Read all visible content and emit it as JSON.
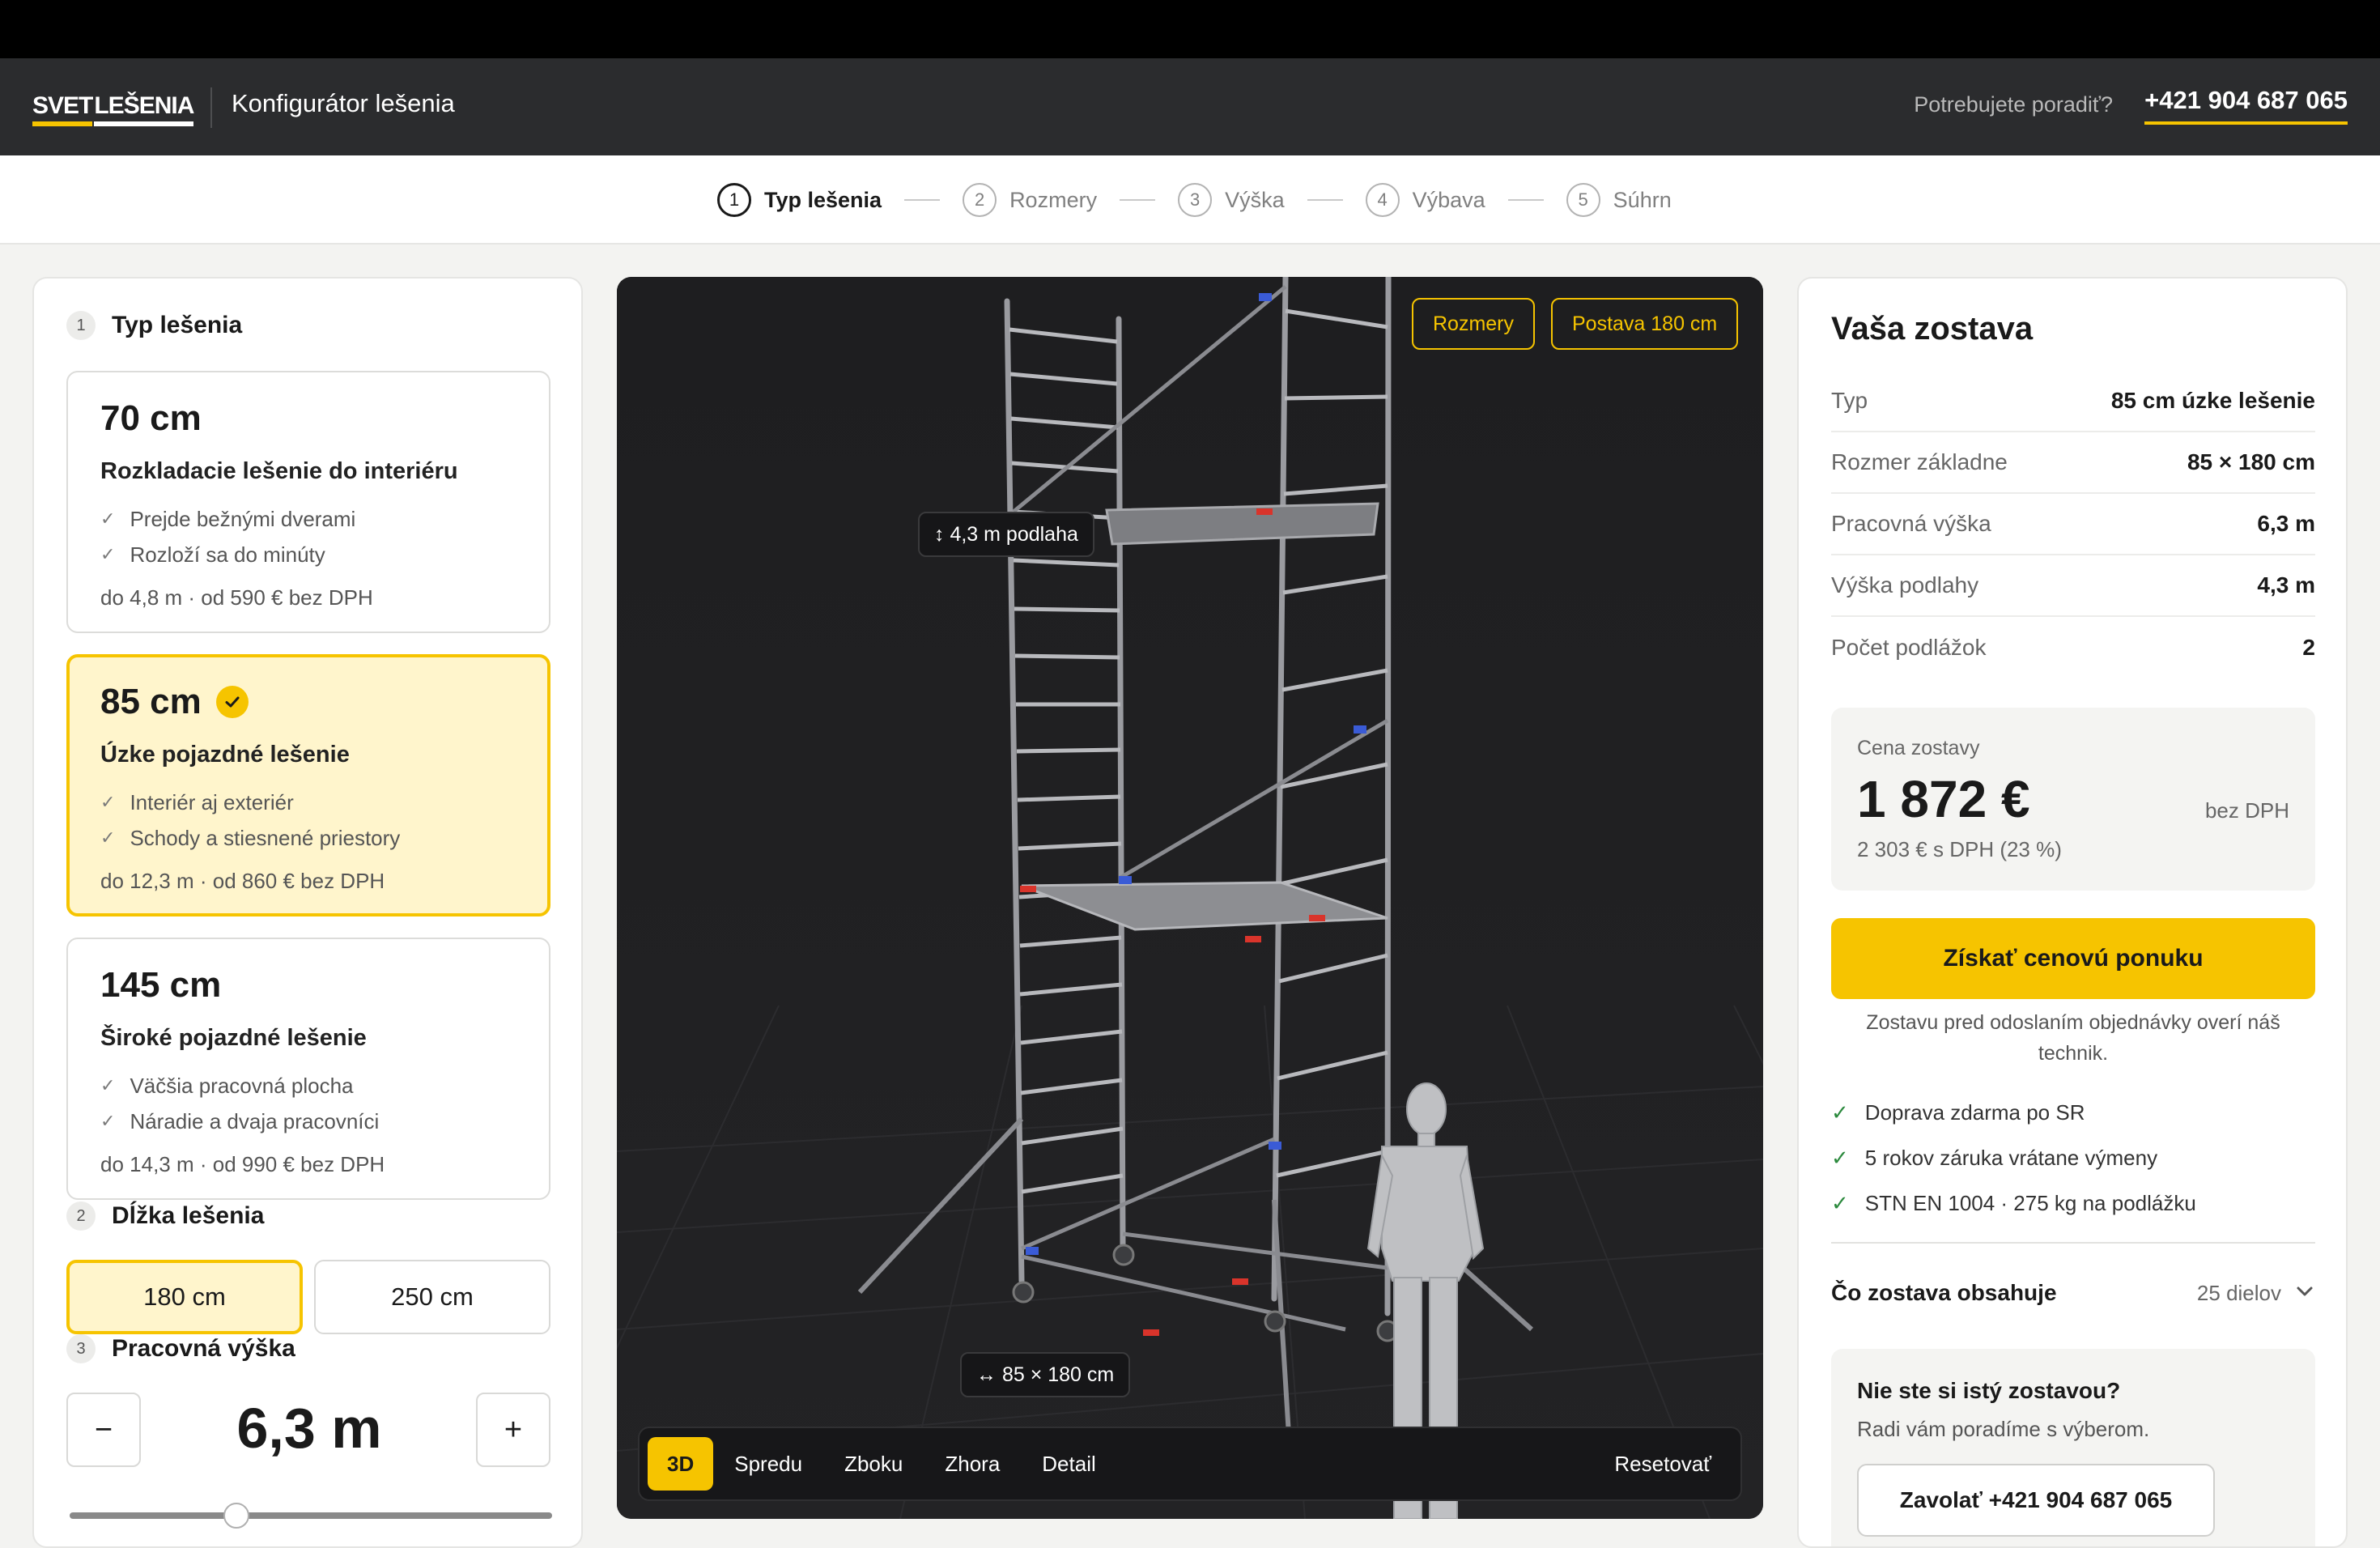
{
  "header": {
    "logo_part1": "SVET",
    "logo_part2": "LEŠENIA",
    "title": "Konfigurátor lešenia",
    "help_text": "Potrebujete poradiť?",
    "phone": "+421 904 687 065"
  },
  "steps": [
    {
      "num": "1",
      "label": "Typ lešenia"
    },
    {
      "num": "2",
      "label": "Rozmery"
    },
    {
      "num": "3",
      "label": "Výška"
    },
    {
      "num": "4",
      "label": "Výbava"
    },
    {
      "num": "5",
      "label": "Súhrn"
    }
  ],
  "left": {
    "section1": {
      "num": "1",
      "title": "Typ lešenia"
    },
    "cards": [
      {
        "title": "70 cm",
        "subtitle": "Rozkladacie lešenie do interiéru",
        "features": [
          "Prejde bežnými dverami",
          "Rozloží sa do minúty"
        ],
        "price": "do 4,8 m · od 590 € bez DPH"
      },
      {
        "title": "85 cm",
        "subtitle": "Úzke pojazdné lešenie",
        "features": [
          "Interiér aj exteriér",
          "Schody a stiesnené priestory"
        ],
        "price": "do 12,3 m · od 860 € bez DPH"
      },
      {
        "title": "145 cm",
        "subtitle": "Široké pojazdné lešenie",
        "features": [
          "Väčšia pracovná plocha",
          "Náradie a dvaja pracovníci"
        ],
        "price": "do 14,3 m · od 990 € bez DPH"
      }
    ],
    "section2": {
      "num": "2",
      "title": "Dĺžka lešenia"
    },
    "lengths": [
      "180 cm",
      "250 cm"
    ],
    "section3": {
      "num": "3",
      "title": "Pracovná výška"
    },
    "height_value": "6,3 m",
    "minus": "−",
    "plus": "+"
  },
  "viewer": {
    "chip_dimensions": "Rozmery",
    "chip_figure": "Postava 180 cm",
    "tag_floor": "↕ 4,3 m podlaha",
    "tag_base": "↔ 85 × 180 cm",
    "views": [
      "3D",
      "Spredu",
      "Zboku",
      "Zhora",
      "Detail"
    ],
    "reset": "Resetovať"
  },
  "summary": {
    "title": "Vaša zostava",
    "rows": [
      {
        "k": "Typ",
        "v": "85 cm úzke lešenie"
      },
      {
        "k": "Rozmer základne",
        "v": "85 × 180 cm"
      },
      {
        "k": "Pracovná výška",
        "v": "6,3 m"
      },
      {
        "k": "Výška podlahy",
        "v": "4,3 m"
      },
      {
        "k": "Počet podlážok",
        "v": "2"
      }
    ],
    "price_label": "Cena zostavy",
    "price": "1 872 €",
    "price_net": "bez DPH",
    "price_vat": "2 303 € s DPH (23 %)",
    "cta": "Získať cenovú ponuku",
    "cta_note": "Zostavu pred odoslaním objednávky overí náš technik.",
    "benefits": [
      "Doprava zdarma po SR",
      "5 rokov záruka vrátane výmeny",
      "STN EN 1004 · 275 kg na podlážku"
    ],
    "contents_label": "Čo zostava obsahuje",
    "contents_count": "25 dielov",
    "help_title": "Nie ste si istý zostavou?",
    "help_sub": "Radi vám poradíme s výberom.",
    "help_button": "Zavolať +421 904 687 065"
  },
  "colors": {
    "accent": "#f6c400",
    "header_bg": "#2b2c2e",
    "viewer_bg": "#1e1e20",
    "success": "#2c8a3e"
  }
}
